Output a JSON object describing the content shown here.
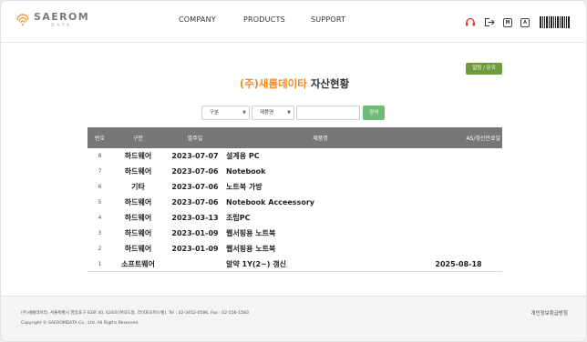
{
  "header": {
    "logo_name": "SAEROM",
    "logo_sub": "DATA",
    "nav": [
      "COMPANY",
      "PRODUCTS",
      "SUPPORT"
    ],
    "icons": [
      "headset-icon",
      "logout-icon",
      "m-box-icon",
      "a-box-icon",
      "barcode-icon"
    ],
    "m_label": "M",
    "a_label": "A"
  },
  "main": {
    "admin_label": "알림 / 문의",
    "title_brand": "(주)새롬데이타",
    "title_rest": "자산현황",
    "filter1": "구분",
    "filter2": "제품명",
    "search_value": "",
    "search_button": "검색"
  },
  "table": {
    "headers": [
      "번호",
      "구분",
      "발주일",
      "제품명",
      "AS/갱신만료일"
    ],
    "rows": [
      {
        "no": "8",
        "cat": "하드웨어",
        "date": "2023-07-07",
        "product": "설계용 PC",
        "expiry": ""
      },
      {
        "no": "7",
        "cat": "하드웨어",
        "date": "2023-07-06",
        "product": "Notebook",
        "expiry": ""
      },
      {
        "no": "6",
        "cat": "기타",
        "date": "2023-07-06",
        "product": "노트북 가방",
        "expiry": ""
      },
      {
        "no": "5",
        "cat": "하드웨어",
        "date": "2023-07-06",
        "product": "Notebook Acceessory",
        "expiry": ""
      },
      {
        "no": "4",
        "cat": "하드웨어",
        "date": "2023-03-13",
        "product": "조립PC",
        "expiry": ""
      },
      {
        "no": "3",
        "cat": "하드웨어",
        "date": "2023-01-09",
        "product": "웹서핑용 노트북",
        "expiry": ""
      },
      {
        "no": "2",
        "cat": "하드웨어",
        "date": "2023-01-09",
        "product": "웹서핑용 노트북",
        "expiry": ""
      },
      {
        "no": "1",
        "cat": "소프트웨어",
        "date": "",
        "product": "알약 1Y(2~) 갱신",
        "expiry": "2025-08-18"
      }
    ]
  },
  "footer": {
    "address": "(주)새롬데이타,  서울특별시 영등포구 63로 40, 624호(여의도동, 라이프오피스텔). Tel : 02-3452-0586,  Fax : 02-556-1583",
    "copyright": "Copyright © SAEROMDATA Co., Ltd. All Rigths Reserved.",
    "privacy": "개인정보취급방침"
  },
  "colors": {
    "brand_orange": "#f08a24",
    "admin_green": "#6f9c3a",
    "search_green": "#6dbb77",
    "table_header": "#777777",
    "headset_red": "#e0312b"
  }
}
